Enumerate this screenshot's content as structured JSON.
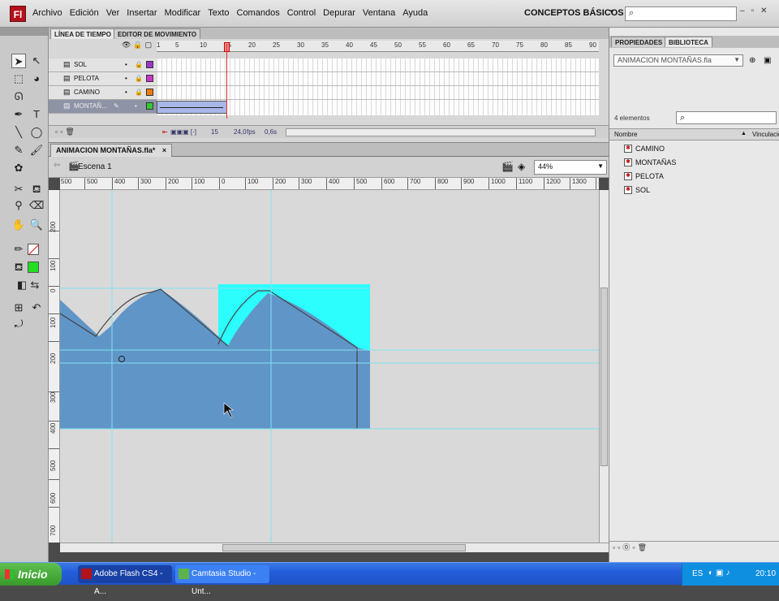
{
  "app": {
    "logo_text": "Fl"
  },
  "menubar": {
    "items": [
      "Archivo",
      "Edición",
      "Ver",
      "Insertar",
      "Modificar",
      "Texto",
      "Comandos",
      "Control",
      "Depurar",
      "Ventana",
      "Ayuda"
    ],
    "workspace": "CONCEPTOS BÁSICOS",
    "search_placeholder": ""
  },
  "timeline": {
    "tabs": [
      "LÍNEA DE TIEMPO",
      "EDITOR DE MOVIMIENTO"
    ],
    "frame_numbers": [
      "1",
      "5",
      "10",
      "15",
      "20",
      "25",
      "30",
      "35",
      "40",
      "45",
      "50",
      "55",
      "60",
      "65",
      "70",
      "75",
      "80",
      "85",
      "90"
    ],
    "current_frame": "15",
    "layers": [
      {
        "name": "SOL",
        "color": "#9b36c9",
        "selected": false
      },
      {
        "name": "PELOTA",
        "color": "#c936c9",
        "selected": false
      },
      {
        "name": "CAMINO",
        "color": "#f07a10",
        "selected": false
      },
      {
        "name": "MONTAÑ...",
        "color": "#36c936",
        "selected": true
      }
    ],
    "footer": {
      "frame": "15",
      "fps": "24,0",
      "fps_unit": "fps",
      "time": "0,6s"
    }
  },
  "document": {
    "tab_title": "ANIMACION MONTAÑAS.fla*",
    "tab_close": "×",
    "scene": "Escena 1",
    "zoom": "44%",
    "h_ruler": [
      "500",
      "500",
      "400",
      "300",
      "200",
      "100",
      "0",
      "100",
      "200",
      "300",
      "400",
      "500",
      "600",
      "700",
      "800",
      "900",
      "1000",
      "1100",
      "1200",
      "1300",
      "140"
    ],
    "v_ruler": [
      "200",
      "100",
      "0",
      "100",
      "200",
      "300",
      "400",
      "500",
      "600",
      "700"
    ]
  },
  "right_panel": {
    "tabs": [
      "PROPIEDADES",
      "BIBLIOTECA"
    ],
    "library_file": "ANIMACION MONTAÑAS.fla",
    "element_count": "4 elementos",
    "columns": [
      "Nombre",
      "Vinculació"
    ],
    "items": [
      "CAMINO",
      "MONTAÑAS",
      "PELOTA",
      "SOL"
    ]
  },
  "taskbar": {
    "start_label": "Inicio",
    "tasks": [
      {
        "label": "Adobe Flash CS4 - A...",
        "active": true
      },
      {
        "label": "Camtasia Studio - Unt...",
        "active": false
      }
    ],
    "language": "ES",
    "clock": "20:10"
  },
  "colors": {
    "mountain_fill": "#6095c8",
    "selection_fill": "#2cfefe",
    "guide_line": "#7fe2ef"
  }
}
